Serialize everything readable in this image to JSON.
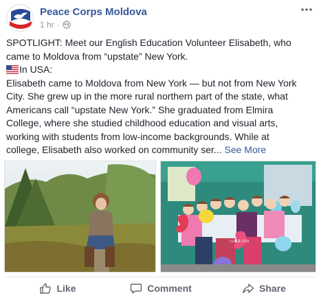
{
  "post": {
    "page_name": "Peace Corps Moldova",
    "timestamp": "1 hr",
    "separator": "·",
    "text_lines": [
      "SPOTLIGHT: Meet our English Education Volunteer Elisabeth, who",
      "came to Moldova from “upstate” New York.",
      "In USA:",
      "Elisabeth came to Moldova from New York — but not from New York",
      "City. She grew up in the more rural northern part of the state, what",
      "Americans call “upstate New York.” She graduated from Elmira",
      "College, where she studied childhood education and visual arts,",
      "working with students from low-income backgrounds. While at",
      "college, Elisabeth also worked on community ser..."
    ],
    "see_more": "See More",
    "flag_icon": "us-flag-icon"
  },
  "photos": {
    "left": {
      "subject": "volunteer-outdoor-photo"
    },
    "right": {
      "subject": "classroom-children-balloons-photo"
    },
    "balloon_text": "I LOVE YOU"
  },
  "actions": {
    "like": "Like",
    "comment": "Comment",
    "share": "Share"
  },
  "colors": {
    "link": "#365899",
    "meta": "#90949c",
    "action": "#606770",
    "text": "#1d2129"
  }
}
